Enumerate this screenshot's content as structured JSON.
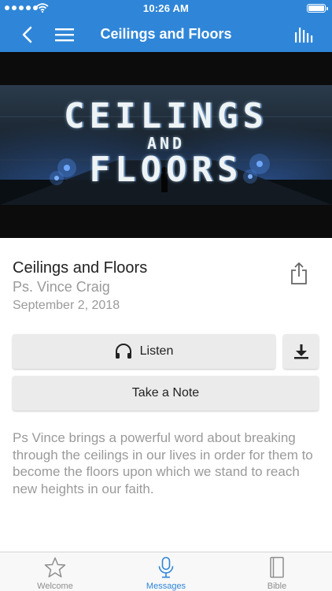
{
  "status_bar": {
    "time": "10:26 AM"
  },
  "nav": {
    "title": "Ceilings and Floors",
    "back_icon": "chevron-left-icon",
    "menu_icon": "hamburger-icon",
    "audio_icon": "audio-bars-icon"
  },
  "hero": {
    "line1": "CEILINGS",
    "line2": "AND",
    "line3": "FLOORS"
  },
  "message": {
    "title": "Ceilings and Floors",
    "speaker": "Ps. Vince Craig",
    "date": "September 2, 2018",
    "description": "Ps Vince brings a powerful word about breaking through the ceilings in our lives in order for them to become the floors upon which we stand to reach new heights in our faith."
  },
  "actions": {
    "listen_label": "Listen",
    "note_label": "Take a Note",
    "share_icon": "share-icon",
    "download_icon": "download-icon",
    "headphones_icon": "headphones-icon"
  },
  "tabs": [
    {
      "label": "Welcome",
      "icon": "star-icon",
      "active": false
    },
    {
      "label": "Messages",
      "icon": "microphone-icon",
      "active": true
    },
    {
      "label": "Bible",
      "icon": "book-icon",
      "active": false
    }
  ],
  "colors": {
    "accent": "#2f86d8",
    "secondary_text": "#9a9a9a",
    "button_bg": "#ebebeb"
  }
}
